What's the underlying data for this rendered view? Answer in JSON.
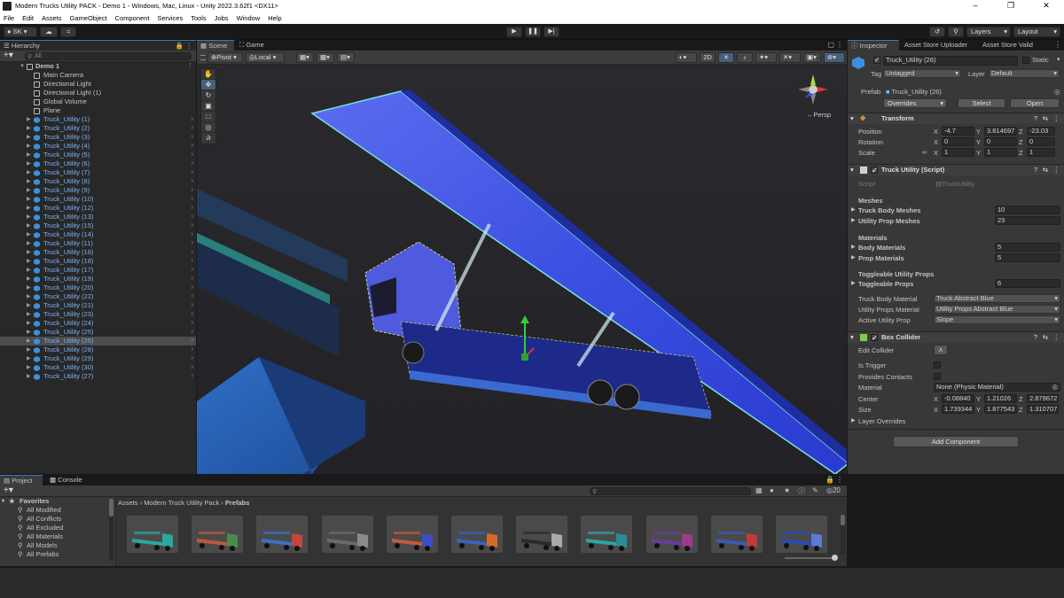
{
  "window": {
    "title": "Modern Trucks Utility PACK - Demo 1 - Windows, Mac, Linux - Unity 2022.3.62f1 <DX11>"
  },
  "menu": [
    "File",
    "Edit",
    "Assets",
    "GameObject",
    "Component",
    "Services",
    "Tools",
    "Jobs",
    "Window",
    "Help"
  ],
  "toolbar": {
    "account": "SK",
    "layers": "Layers",
    "layout": "Layout"
  },
  "hierarchy": {
    "tab": "Hierarchy",
    "search_placeholder": "All",
    "scene": "Demo 1",
    "children": [
      "Main Camera",
      "Directional Light",
      "Directional Light (1)",
      "Global Volume",
      "Plane"
    ],
    "trucks": [
      "Truck_Utility (1)",
      "Truck_Utility (2)",
      "Truck_Utility (3)",
      "Truck_Utility (4)",
      "Truck_Utility (5)",
      "Truck_Utility (6)",
      "Truck_Utility (7)",
      "Truck_Utility (8)",
      "Truck_Utility (9)",
      "Truck_Utility (10)",
      "Truck_Utility (12)",
      "Truck_Utility (13)",
      "Truck_Utility (15)",
      "Truck_Utility (14)",
      "Truck_Utility (11)",
      "Truck_Utility (16)",
      "Truck_Utility (18)",
      "Truck_Utility (17)",
      "Truck_Utility (19)",
      "Truck_Utility (20)",
      "Truck_Utility (22)",
      "Truck_Utility (21)",
      "Truck_Utility (23)",
      "Truck_Utility (24)",
      "Truck_Utility (25)",
      "Truck_Utility (26)",
      "Truck_Utility (28)",
      "Truck_Utility (29)",
      "Truck_Utility (30)",
      "Truck_Utility (27)"
    ],
    "selected": "Truck_Utility (26)"
  },
  "scene": {
    "tab_scene": "Scene",
    "tab_game": "Game",
    "pivot": "Pivot",
    "space": "Local",
    "mode_2d": "2D",
    "persp": "Persp"
  },
  "inspector": {
    "tabs": [
      "Inspector",
      "Asset Store Uploader",
      "Asset Store Valid"
    ],
    "name": "Truck_Utility (26)",
    "static": "Static",
    "tag_label": "Tag",
    "tag": "Untagged",
    "layer_label": "Layer",
    "layer": "Default",
    "prefab_label": "Prefab",
    "prefab": "Truck_Utility (26)",
    "overrides": "Overrides",
    "select": "Select",
    "open": "Open",
    "transform": {
      "title": "Transform",
      "position_label": "Position",
      "position": [
        "-4.7",
        "3.814697",
        "-23.03"
      ],
      "rotation_label": "Rotation",
      "rotation": [
        "0",
        "0",
        "0"
      ],
      "scale_label": "Scale",
      "scale": [
        "1",
        "1",
        "1"
      ]
    },
    "script": {
      "title": "Truck Utility (Script)",
      "script_label": "Script",
      "script_value": "TruckUtility",
      "meshes_header": "Meshes",
      "truck_body_meshes_label": "Truck Body Meshes",
      "truck_body_meshes": "10",
      "utility_prop_meshes_label": "Utility Prop Meshes",
      "utility_prop_meshes": "23",
      "materials_header": "Materials",
      "body_materials_label": "Body Materials",
      "body_materials": "5",
      "prop_materials_label": "Prop Materials",
      "prop_materials": "5",
      "toggle_header": "Toggleable Utility Props",
      "toggle_props_label": "Toggleable Props",
      "toggle_props": "6",
      "truck_body_material_label": "Truck Body Material",
      "truck_body_material": "Truck Abstract Blue",
      "utility_props_material_label": "Utility Props Material",
      "utility_props_material": "Utility Props Abstract Blue",
      "active_prop_label": "Active Utility Prop",
      "active_prop": "Slope"
    },
    "collider": {
      "title": "Box Collider",
      "edit_label": "Edit Collider",
      "is_trigger_label": "Is Trigger",
      "provides_contacts_label": "Provides Contacts",
      "material_label": "Material",
      "material": "None (Physic Material)",
      "center_label": "Center",
      "center": [
        "-0.08840",
        "1.21026",
        "2.879672"
      ],
      "size_label": "Size",
      "size": [
        "1.739344",
        "1.877543",
        "1.310707"
      ],
      "layer_overrides": "Layer Overrides"
    },
    "add_component": "Add Component"
  },
  "project": {
    "tab_project": "Project",
    "tab_console": "Console",
    "hidden_count": "20",
    "favorites": "Favorites",
    "fav_items": [
      "All Modified",
      "All Conflicts",
      "All Excluded",
      "All Materials",
      "All Models",
      "All Prefabs"
    ],
    "breadcrumb": [
      "Assets",
      "Modern Truck Utility Pack",
      "Prefabs"
    ],
    "thumbs": [
      {
        "color": "#2aa7a0",
        "cab": "#2aa7a0"
      },
      {
        "color": "#b85a3a",
        "cab": "#4b8a4b"
      },
      {
        "color": "#3b6fc4",
        "cab": "#c4453b"
      },
      {
        "color": "#6a6a6a",
        "cab": "#8a8a8a"
      },
      {
        "color": "#c45a3a",
        "cab": "#3b4fc4"
      },
      {
        "color": "#3b5fc4",
        "cab": "#d46a2a"
      },
      {
        "color": "#2a2a2a",
        "cab": "#aaaaaa"
      },
      {
        "color": "#2aa7a0",
        "cab": "#2a8a9a"
      },
      {
        "color": "#6a3aa0",
        "cab": "#a03a8a"
      },
      {
        "color": "#3a5ab4",
        "cab": "#c43a3a"
      },
      {
        "color": "#2a4ab4",
        "cab": "#5a7ad4"
      }
    ]
  },
  "colors": {
    "accent": "#3a79bb",
    "selection": "#4d4d4d",
    "prefab_blue": "#7ab4f5"
  }
}
